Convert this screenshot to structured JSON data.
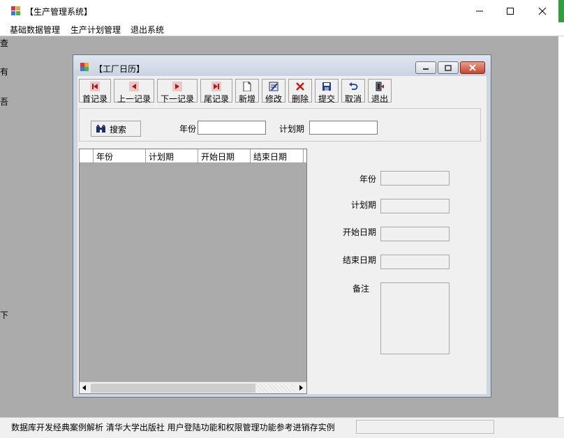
{
  "app": {
    "title": "【生产管理系统】"
  },
  "menu": [
    {
      "label": "基础数据管理"
    },
    {
      "label": "生产计划管理"
    },
    {
      "label": "退出系统"
    }
  ],
  "background_fragments": [
    "查",
    "有",
    "吾",
    "下"
  ],
  "child": {
    "title": "【工厂日历】"
  },
  "toolbar": {
    "buttons": [
      {
        "label": "首记录",
        "icon": "first-record-icon"
      },
      {
        "label": "上一记录",
        "icon": "previous-record-icon"
      },
      {
        "label": "下一记录",
        "icon": "next-record-icon"
      },
      {
        "label": "尾记录",
        "icon": "last-record-icon"
      },
      {
        "label": "新增",
        "icon": "new-document-icon"
      },
      {
        "label": "修改",
        "icon": "edit-icon"
      },
      {
        "label": "删除",
        "icon": "delete-icon"
      },
      {
        "label": "提交",
        "icon": "save-icon"
      },
      {
        "label": "取消",
        "icon": "undo-icon"
      },
      {
        "label": "退出",
        "icon": "exit-icon"
      }
    ]
  },
  "search": {
    "button_label": "搜索",
    "year_label": "年份",
    "year_value": "",
    "period_label": "计划期",
    "period_value": ""
  },
  "grid": {
    "columns": [
      "年份",
      "计划期",
      "开始日期",
      "结束日期"
    ],
    "rows": []
  },
  "details": {
    "year_label": "年份",
    "period_label": "计划期",
    "start_label": "开始日期",
    "end_label": "结束日期",
    "note_label": "备注"
  },
  "status": {
    "text": "数据库开发经典案例解析   清华大学出版社   用户登陆功能和权限管理功能参考进销存实例"
  },
  "colors": {
    "accent_green": "#2e9f3a",
    "mdi_background": "#ababab"
  }
}
